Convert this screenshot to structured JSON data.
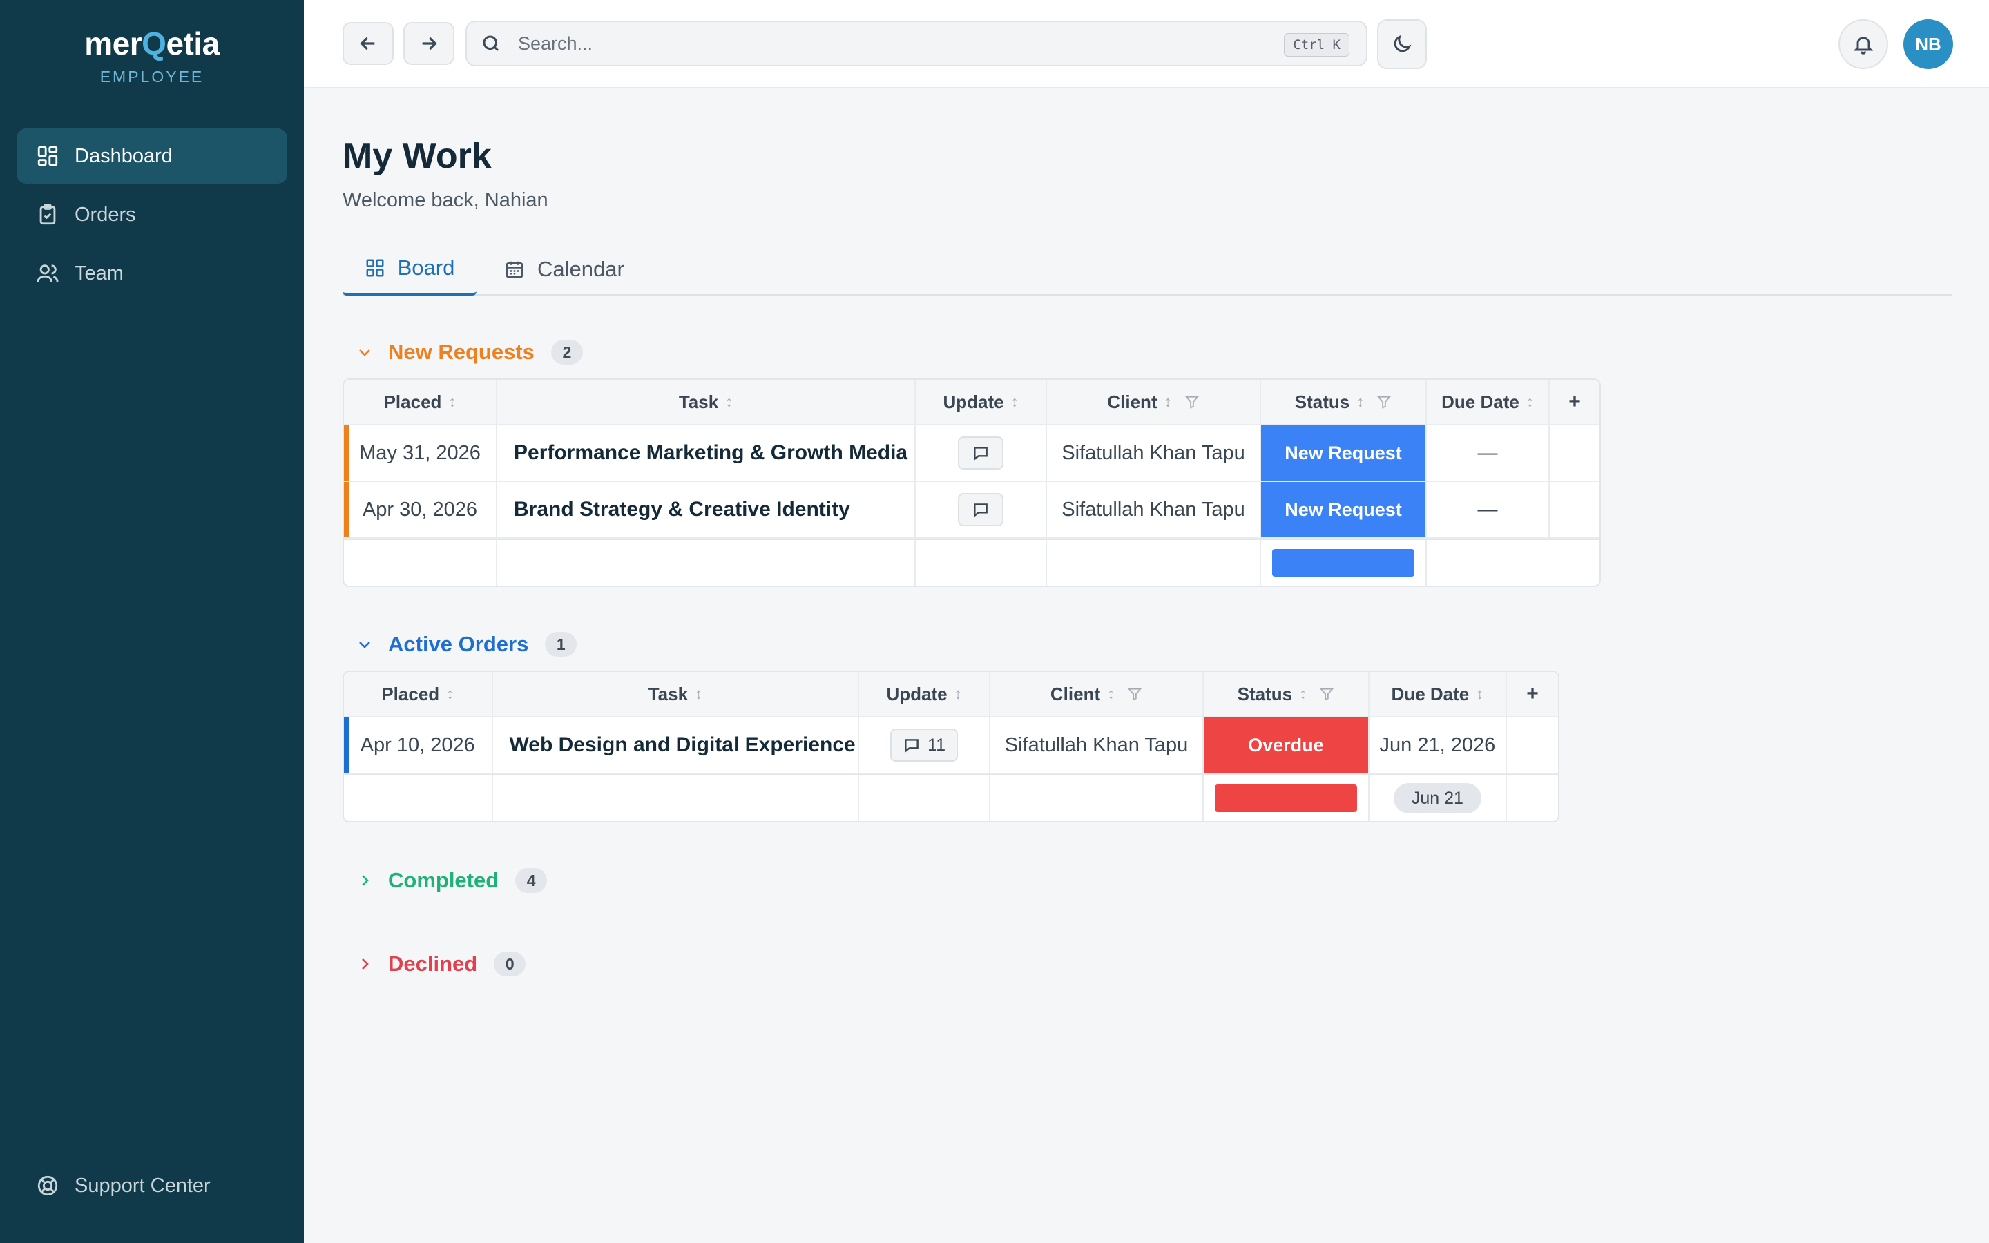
{
  "brand": {
    "name_prefix": "mer",
    "name_q": "Q",
    "name_suffix": "etia",
    "subtitle": "EMPLOYEE"
  },
  "sidebar": {
    "items": [
      {
        "label": "Dashboard",
        "icon": "grid-icon",
        "active": true
      },
      {
        "label": "Orders",
        "icon": "clipboard-check-icon",
        "active": false
      },
      {
        "label": "Team",
        "icon": "users-icon",
        "active": false
      }
    ],
    "support_label": "Support Center"
  },
  "topbar": {
    "search_placeholder": "Search...",
    "shortcut": "Ctrl K",
    "avatar_initials": "NB"
  },
  "page": {
    "title": "My Work",
    "subtitle": "Welcome back, Nahian",
    "tabs": [
      {
        "label": "Board",
        "active": true
      },
      {
        "label": "Calendar",
        "active": false
      }
    ]
  },
  "columns": {
    "placed": "Placed",
    "task": "Task",
    "update": "Update",
    "client": "Client",
    "status": "Status",
    "due": "Due Date",
    "add": "+"
  },
  "groups": {
    "new_requests": {
      "title": "New Requests",
      "count": "2",
      "color": "#f07f1d",
      "rows": [
        {
          "placed": "May 31, 2026",
          "task": "Performance Marketing & Growth Media",
          "update_count": "",
          "client": "Sifatullah Khan Tapu",
          "status": "New Request",
          "due": "—"
        },
        {
          "placed": "Apr 30, 2026",
          "task": "Brand Strategy & Creative Identity",
          "update_count": "",
          "client": "Sifatullah Khan Tapu",
          "status": "New Request",
          "due": "—"
        }
      ],
      "status_color": "#3b82f6"
    },
    "active_orders": {
      "title": "Active Orders",
      "count": "1",
      "color": "#1f6fd1",
      "rows": [
        {
          "placed": "Apr 10, 2026",
          "task": "Web Design and Digital Experience",
          "update_count": "11",
          "client": "Sifatullah Khan Tapu",
          "status": "Overdue",
          "due": "Jun 21, 2026"
        }
      ],
      "status_color": "#ef4444",
      "summary_due": "Jun 21"
    },
    "completed": {
      "title": "Completed",
      "count": "4",
      "color": "#1fb276"
    },
    "declined": {
      "title": "Declined",
      "count": "0",
      "color": "#e0414f"
    }
  }
}
